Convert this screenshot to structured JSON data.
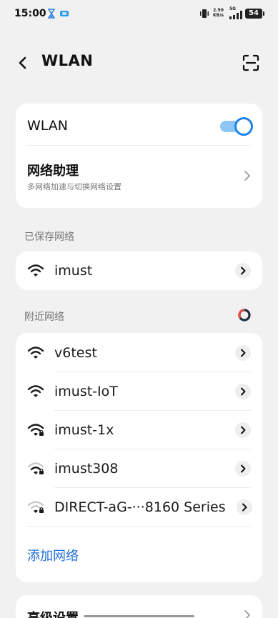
{
  "status_bar": {
    "time": "15:00",
    "speed_value": "2.90",
    "speed_unit": "KB/s",
    "network_type": "5G",
    "battery": "54"
  },
  "header": {
    "title": "WLAN",
    "back_icon": "chevron-left-icon",
    "scan_icon": "scan-qr-icon"
  },
  "wlan_card": {
    "wlan_label": "WLAN",
    "wlan_enabled": true,
    "assistant_title": "网络助理",
    "assistant_subtitle": "多网络加速与切换网络设置"
  },
  "saved_networks": {
    "section_label": "已保存网络",
    "items": [
      {
        "name": "imust",
        "signal": "full",
        "locked": false
      }
    ]
  },
  "nearby_networks": {
    "section_label": "附近网络",
    "items": [
      {
        "name": "v6test",
        "signal": "full",
        "locked": false
      },
      {
        "name": "imust-IoT",
        "signal": "full",
        "locked": false
      },
      {
        "name": "imust-1x",
        "signal": "full",
        "locked": true
      },
      {
        "name": "imust308",
        "signal": "medium",
        "locked": true
      },
      {
        "name": "DIRECT-aG-···8160 Series",
        "signal": "weak",
        "locked": true
      }
    ],
    "add_network_label": "添加网络"
  },
  "advanced": {
    "label": "高级设置"
  },
  "colors": {
    "accent": "#1e82e6",
    "link": "#1e6fd9",
    "background": "#f1f1f1",
    "card": "#ffffff"
  }
}
